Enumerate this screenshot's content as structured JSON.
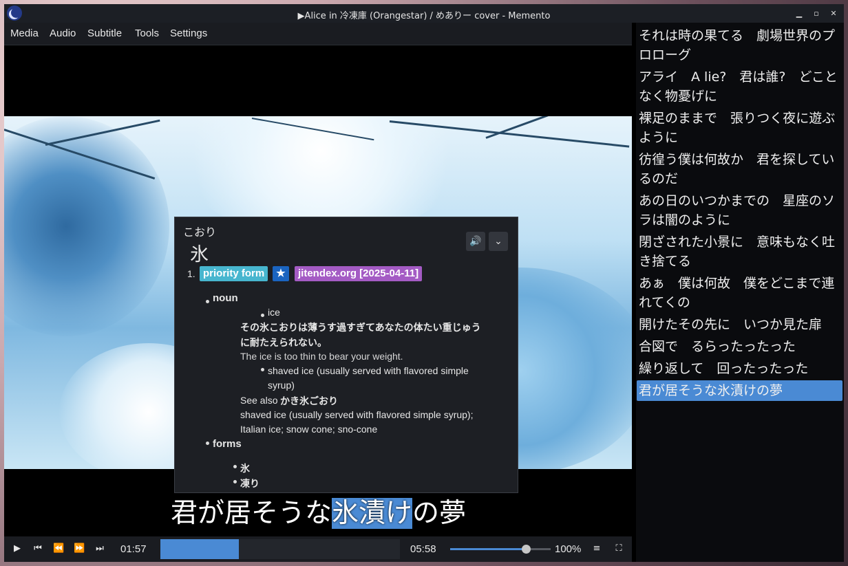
{
  "window": {
    "title": "▶Alice in 冷凍庫 (Orangestar) / めありー cover - Memento"
  },
  "menu": [
    "Media",
    "Audio",
    "Subtitle",
    "Tools",
    "Settings"
  ],
  "subtitle": {
    "before": "君が居そうな",
    "highlight": "氷漬け",
    "after": "の夢"
  },
  "popup": {
    "reading": "こおり",
    "term": "氷",
    "entry_number": "1.",
    "tags": [
      "priority form",
      "★",
      "jitendex.org [2025-04-11]"
    ],
    "pos": "noun",
    "gloss1": "ice",
    "example_jp_line1": "その氷こおりは薄うす過すぎてあなたの体たい重じゅう",
    "example_jp_line2": "に耐たえられない。",
    "example_en": "The ice is too thin to bear your weight.",
    "gloss2_line1": "shaved ice (usually served with flavored simple",
    "gloss2_line2": "syrup)",
    "see_also_label": "See also",
    "see_also_term": "かき氷ごおり",
    "see_also_gloss_line1": "shaved ice (usually served with flavored simple syrup);",
    "see_also_gloss_line2": "Italian ice; snow cone; sno-cone",
    "forms_label": "forms",
    "forms": [
      "氷",
      "凍り"
    ]
  },
  "controls": {
    "current_time": "01:57",
    "total_time": "05:58",
    "progress": 0.327,
    "volume_label": "100%",
    "volume": 0.75
  },
  "sublist": [
    {
      "line1": "それは時の果てる　劇場世界のプ",
      "line2": "ロローグ"
    },
    {
      "line1": "アライ　A lie?　君は誰?　どこと",
      "line2": "なく物憂げに"
    },
    {
      "line1": "裸足のままで　張りつく夜に遊ぶ",
      "line2": "ように"
    },
    {
      "line1": "彷徨う僕は何故か　君を探してい",
      "line2": "るのだ"
    },
    {
      "line1": "あの日のいつかまでの　星座のソ",
      "line2": "ラは闇のように"
    },
    {
      "line1": "閉ざされた小景に　意味もなく吐",
      "line2": "き捨てる"
    },
    {
      "line1": "あぁ　僕は何故　僕をどこまで連",
      "line2": "れてくの"
    },
    {
      "line1": "開けたその先に　いつか見た扉"
    },
    {
      "line1": "合図で　るらったったった"
    },
    {
      "line1": "繰り返して　回ったったった"
    },
    {
      "line1": "君が居そうな氷漬けの夢"
    }
  ],
  "sublist_active_index": 10
}
